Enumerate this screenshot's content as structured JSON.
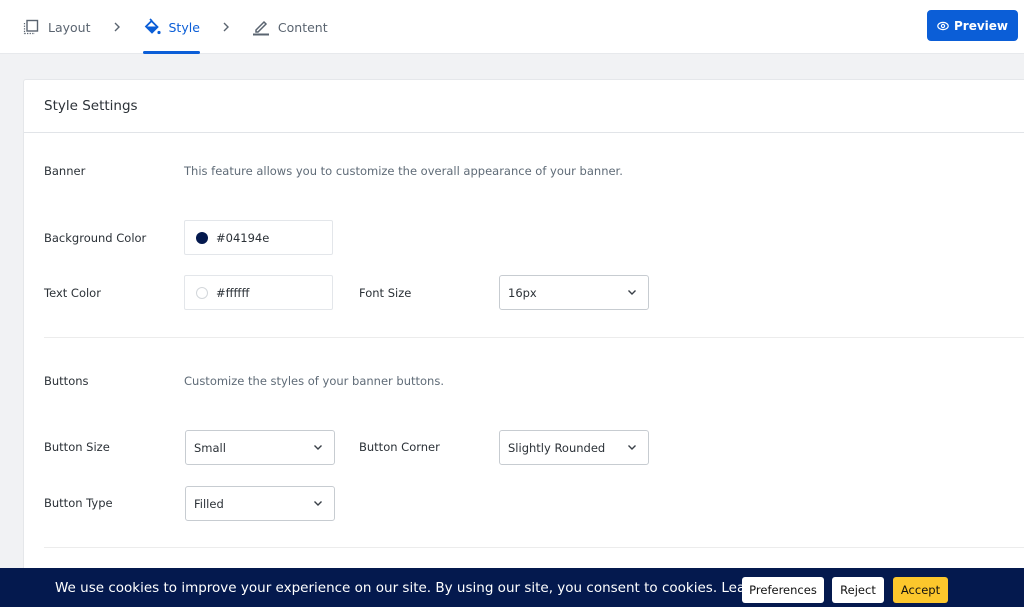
{
  "nav": {
    "steps": [
      {
        "label": "Layout",
        "icon": "layout-icon",
        "active": false
      },
      {
        "label": "Style",
        "icon": "paint-bucket-icon",
        "active": true
      },
      {
        "label": "Content",
        "icon": "pencil-icon",
        "active": false
      }
    ],
    "preview_label": "Preview"
  },
  "card": {
    "title": "Style Settings",
    "banner": {
      "label": "Banner",
      "description": "This feature allows you to customize the overall appearance of your banner.",
      "background_color": {
        "label": "Background Color",
        "value": "#04194e"
      },
      "text_color": {
        "label": "Text Color",
        "value": "#ffffff"
      },
      "font_size": {
        "label": "Font Size",
        "value": "16px"
      }
    },
    "buttons": {
      "label": "Buttons",
      "description": "Customize the styles of your banner buttons.",
      "button_size": {
        "label": "Button Size",
        "value": "Small"
      },
      "button_corner": {
        "label": "Button Corner",
        "value": "Slightly Rounded"
      },
      "button_type": {
        "label": "Button Type",
        "value": "Filled"
      }
    }
  },
  "cookie_banner": {
    "text": "We use cookies to improve your experience on our site. By using our site, you consent to cookies. Learn More.",
    "preferences_label": "Preferences",
    "reject_label": "Reject",
    "accept_label": "Accept",
    "background": "#04194e",
    "accept_color": "#fcc72c"
  },
  "colors": {
    "accent": "#0b5ed7"
  }
}
